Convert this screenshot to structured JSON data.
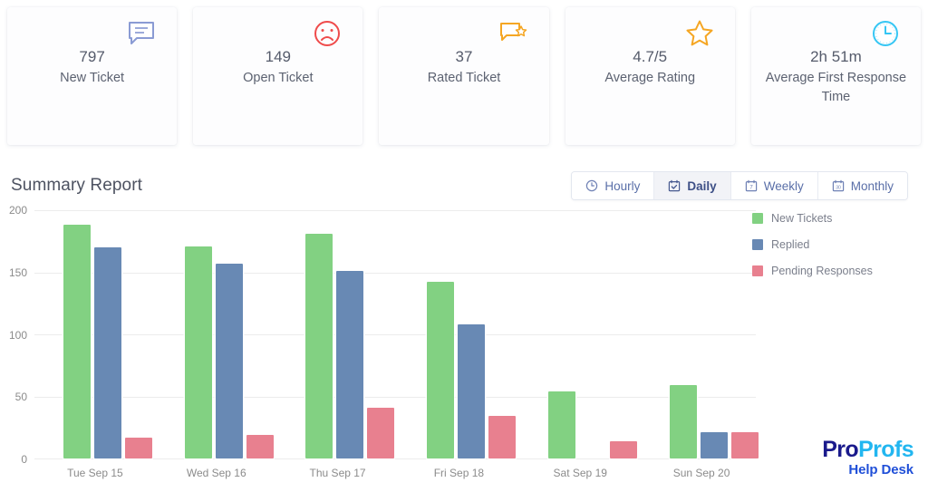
{
  "cards": [
    {
      "value": "797",
      "label": "New Ticket",
      "icon": "chat-bubble-icon",
      "color": "#8a9bd4"
    },
    {
      "value": "149",
      "label": "Open Ticket",
      "icon": "sad-face-icon",
      "color": "#ef4b4b"
    },
    {
      "value": "37",
      "label": "Rated Ticket",
      "icon": "chat-star-icon",
      "color": "#f5a623"
    },
    {
      "value": "4.7/5",
      "label": "Average Rating",
      "icon": "star-icon",
      "color": "#f5a623"
    },
    {
      "value": "2h 51m",
      "label": "Average First Response Time",
      "icon": "clock-icon",
      "color": "#35c6f4"
    }
  ],
  "section": {
    "title": "Summary Report"
  },
  "tabs": [
    {
      "label": "Hourly",
      "icon": "clock-icon",
      "active": false
    },
    {
      "label": "Daily",
      "icon": "calendar-check-icon",
      "active": true
    },
    {
      "label": "Weekly",
      "icon": "calendar-7-icon",
      "active": false
    },
    {
      "label": "Monthly",
      "icon": "calendar-30-icon",
      "active": false
    }
  ],
  "chart_data": {
    "type": "bar",
    "title": "Summary Report",
    "xlabel": "",
    "ylabel": "",
    "ylim": [
      0,
      200
    ],
    "yticks": [
      0,
      50,
      100,
      150,
      200
    ],
    "grid": true,
    "legend_position": "right",
    "categories": [
      "Tue Sep 15",
      "Wed Sep 16",
      "Thu Sep 17",
      "Fri Sep 18",
      "Sat Sep 19",
      "Sun Sep 20"
    ],
    "series": [
      {
        "name": "New Tickets",
        "color": "#82d182",
        "values": [
          188,
          171,
          181,
          142,
          54,
          59
        ]
      },
      {
        "name": "Replied",
        "color": "#6889b4",
        "values": [
          170,
          157,
          151,
          108,
          0,
          21
        ]
      },
      {
        "name": "Pending Responses",
        "color": "#e8808f",
        "values": [
          17,
          19,
          41,
          34,
          14,
          21
        ]
      }
    ]
  },
  "logo": {
    "part1": "Pro",
    "part2": "Profs",
    "subtitle": "Help Desk"
  }
}
